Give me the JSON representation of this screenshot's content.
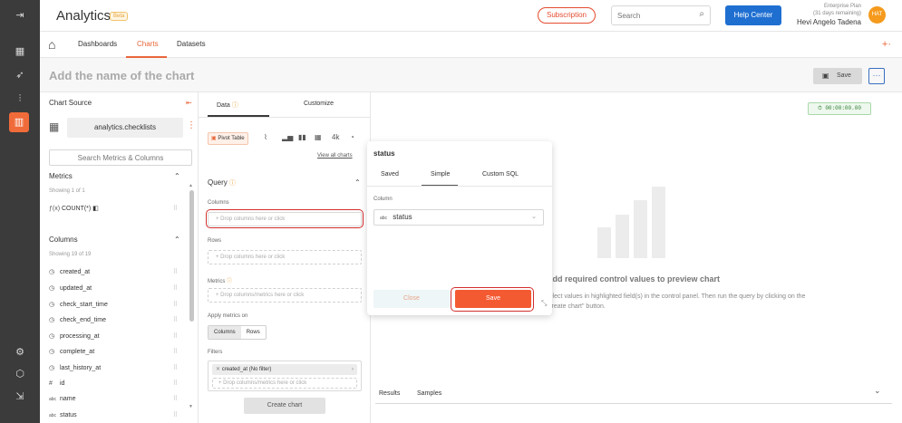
{
  "app": {
    "title": "Analytics",
    "badge": "Beta"
  },
  "topbar": {
    "subscription": "Subscription",
    "search_placeholder": "Search",
    "help_center": "Help Center",
    "plan_line1": "Enterprise Plan",
    "plan_line2": "(31 days remaining)",
    "user_name": "Hevi Angelo Tadena",
    "avatar_initials": "HAT"
  },
  "nav": {
    "tabs": [
      "Dashboards",
      "Charts",
      "Datasets"
    ],
    "active": "Charts"
  },
  "titlebar": {
    "chart_name_placeholder": "Add the name of the chart",
    "save_label": "Save",
    "more_label": "···"
  },
  "source": {
    "title": "Chart Source",
    "dataset": "analytics.checklists",
    "search_placeholder": "Search Metrics & Columns",
    "metrics_heading": "Metrics",
    "metrics_count": "Showing 1 of 1",
    "metrics": [
      {
        "icon": "ƒ(x)",
        "label": "COUNT(*)"
      }
    ],
    "columns_heading": "Columns",
    "columns_count": "Showing 19 of 19",
    "columns": [
      {
        "icon": "◷",
        "label": "created_at"
      },
      {
        "icon": "◷",
        "label": "updated_at"
      },
      {
        "icon": "◷",
        "label": "check_start_time"
      },
      {
        "icon": "◷",
        "label": "check_end_time"
      },
      {
        "icon": "◷",
        "label": "processing_at"
      },
      {
        "icon": "◷",
        "label": "complete_at"
      },
      {
        "icon": "◷",
        "label": "last_history_at"
      },
      {
        "icon": "#",
        "label": "id"
      },
      {
        "icon": "abc",
        "label": "name"
      },
      {
        "icon": "abc",
        "label": "status"
      }
    ]
  },
  "control": {
    "tabs": [
      "Data",
      "Customize"
    ],
    "active_tab": "Data",
    "chart_type": "Pivot Table",
    "view_all": "View all charts",
    "big_number": "4k",
    "query_title": "Query",
    "columns_label": "Columns",
    "columns_drop": "Drop columns here or click",
    "rows_label": "Rows",
    "rows_drop": "Drop columns here or click",
    "metrics_label": "Metrics",
    "metrics_drop": "Drop columns/metrics here or click",
    "apply_label": "Apply metrics on",
    "apply_options": [
      "Columns",
      "Rows"
    ],
    "apply_selected": "Columns",
    "filters_label": "Filters",
    "filter_pill": "created_at (No filter)",
    "filters_drop": "Drop columns/metrics here or click",
    "create_chart": "Create chart"
  },
  "preview": {
    "timer": "00:00:00.00",
    "message_title": "Add required control values to preview chart",
    "message_body": "Select values in highlighted field(s) in the control panel. Then run the query by clicking on the \"Create chart\" button.",
    "result_tabs": [
      "Results",
      "Samples"
    ]
  },
  "popover": {
    "title": "status",
    "tabs": [
      "Saved",
      "Simple",
      "Custom SQL"
    ],
    "active_tab": "Simple",
    "column_label": "Column",
    "column_type": "abc",
    "column_value": "status",
    "close": "Close",
    "save": "Save"
  },
  "colors": {
    "accent": "#f06b3a",
    "primary_blue": "#1f6fd1",
    "rail": "#3b3b3b",
    "highlight_ring": "#d42e2e"
  }
}
